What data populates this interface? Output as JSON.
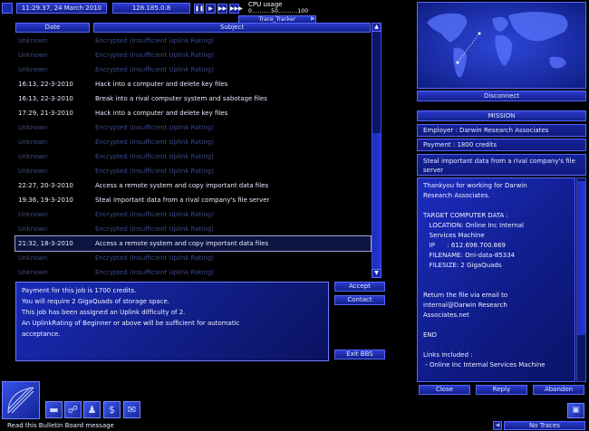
{
  "top_bar": {
    "clock": "11:29.37, 24 March 2010",
    "ip": "128.185.0.8",
    "speed_glyphs": [
      "❚❚",
      "▶",
      "▶▶",
      "▶▶▶"
    ],
    "cpu_label": "CPU usage",
    "cpu_scale": "0..........50..........100",
    "trace_tracker": "Trace_Tracker",
    "trace_tracker_left_arrow": "◀",
    "trace_tracker_right_arrow": "▶"
  },
  "table": {
    "headers": {
      "date": "Date",
      "subject": "Subject"
    },
    "rows": [
      {
        "date": "Unknown",
        "subject": "Encrypted (Insufficient Uplink Rating)",
        "known": false
      },
      {
        "date": "Unknown",
        "subject": "Encrypted (Insufficient Uplink Rating)",
        "known": false
      },
      {
        "date": "Unknown",
        "subject": "Encrypted (Insufficient Uplink Rating)",
        "known": false
      },
      {
        "date": "16:13, 22-3-2010",
        "subject": "Hack into a computer and delete key files",
        "known": true
      },
      {
        "date": "16:13, 22-3-2010",
        "subject": "Break into a rival computer system and sabotage files",
        "known": true
      },
      {
        "date": "17:29, 21-3-2010",
        "subject": "Hack into a computer and delete key files",
        "known": true
      },
      {
        "date": "Unknown",
        "subject": "Encrypted (Insufficient Uplink Rating)",
        "known": false
      },
      {
        "date": "Unknown",
        "subject": "Encrypted (Insufficient Uplink Rating)",
        "known": false
      },
      {
        "date": "Unknown",
        "subject": "Encrypted (Insufficient Uplink Rating)",
        "known": false
      },
      {
        "date": "Unknown",
        "subject": "Encrypted (Insufficient Uplink Rating)",
        "known": false
      },
      {
        "date": "22:27, 20-3-2010",
        "subject": "Access a remote system and copy important data files",
        "known": true
      },
      {
        "date": "19:36, 19-3-2010",
        "subject": "Steal important data from a rival company's file server",
        "known": true
      },
      {
        "date": "Unknown",
        "subject": "Encrypted (Insufficient Uplink Rating)",
        "known": false
      },
      {
        "date": "Unknown",
        "subject": "Encrypted (Insufficient Uplink Rating)",
        "known": false
      },
      {
        "date": "21:32, 18-3-2010",
        "subject": "Access a remote system and copy important data files",
        "known": true,
        "selected": true
      },
      {
        "date": "Unknown",
        "subject": "Encrypted (Insufficient Uplink Rating)",
        "known": false
      },
      {
        "date": "Unknown",
        "subject": "Encrypted (Insufficient Uplink Rating)",
        "known": false
      }
    ],
    "scroll_up": "▲",
    "scroll_down": "▼"
  },
  "details": {
    "lines": [
      "Payment for this job is 1700 credits.",
      "You will require 2 GigaQuads of storage space.",
      "This job has been assigned an Uplink difficulty of 2.",
      "An UplinkRating of Beginner or above will be sufficient for automatic",
      "acceptance."
    ]
  },
  "actions": {
    "accept": "Accept",
    "contact": "Contact",
    "exit": "Exit BBS"
  },
  "bottom_bar": {
    "icons": [
      "▬",
      "☍",
      "♟",
      "$",
      "✉"
    ],
    "status": "Read this Bulletin Board message"
  },
  "right_panel": {
    "disconnect": "Disconnect",
    "mission_title": "MISSION",
    "employer": "Employer : Darwin Research Associates",
    "payment": "Payment : 1800 credits",
    "summary": "Steal important data from a rival company's file server",
    "letter_lines": [
      "Thankyou for working for Darwin",
      "Research Associates.",
      "",
      "TARGET COMPUTER DATA :",
      "   LOCATION: Online Inc Internal",
      "   Services Machine",
      "   IP      : 612.698.700.869",
      "   FILENAME: Oni-data-85334",
      "   FILESIZE: 2 GigaQuads",
      "",
      "",
      "Return the file via email to",
      "internal@Darwin Research",
      "Associates.net",
      "",
      "END",
      "",
      "Links included :",
      " - Online Inc Internal Services Machine"
    ],
    "buttons": {
      "close": "Close",
      "reply": "Reply",
      "abandon": "Abandon"
    },
    "no_traces": "No Traces",
    "no_traces_arrow": "◀",
    "trace_icon": "▣"
  },
  "colors": {
    "accent": "#1e30c8",
    "text": "#e6ecff",
    "encrypted_text": "#3d4a88"
  }
}
